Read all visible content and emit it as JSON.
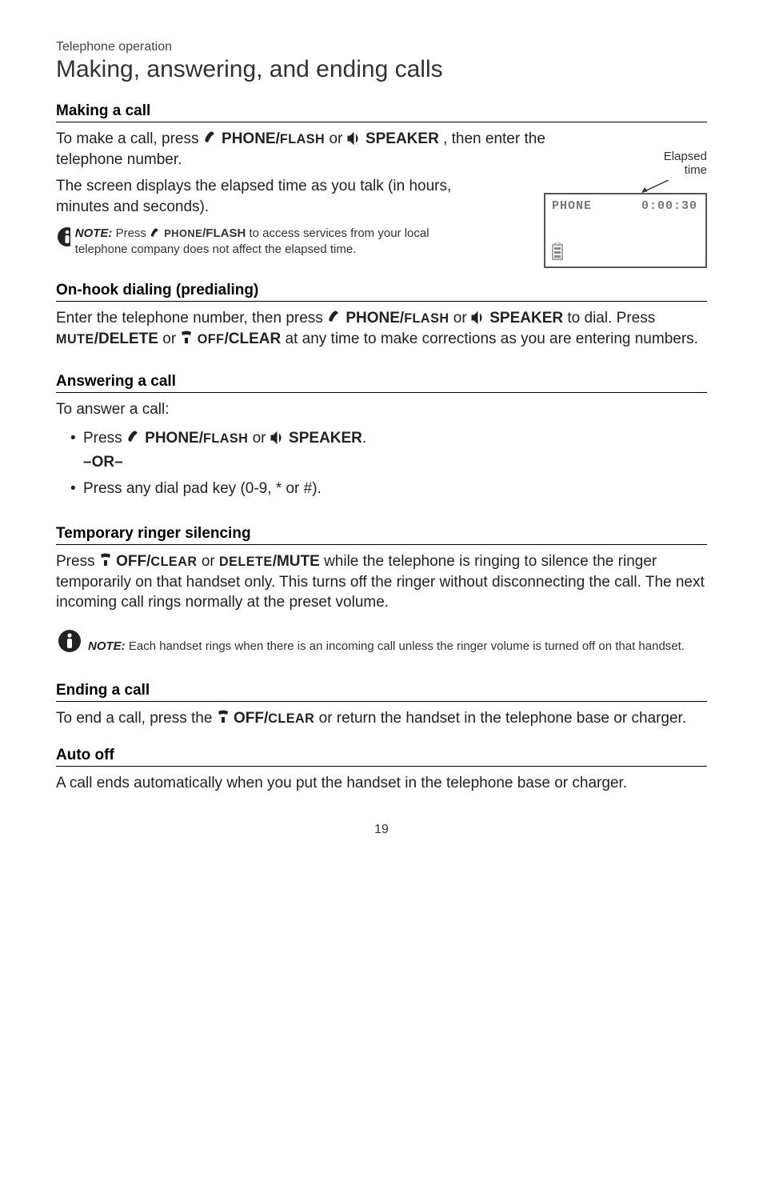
{
  "header": {
    "pre_title": "Telephone operation",
    "title": "Making, answering, and ending calls"
  },
  "making_call": {
    "heading": "Making a call",
    "p1_a": "To make a call, press ",
    "p1_phone": "PHONE/",
    "p1_flash": "FLASH",
    "p1_or": " or ",
    "p1_speaker": "SPEAKER",
    "p1_b": ", then enter the telephone number.",
    "p2": "The screen displays the elapsed time as you talk (in hours, minutes and seconds).",
    "note_label": "NOTE:",
    "note_a": " Press ",
    "note_phone": "PHONE",
    "note_flash": "/FLASH",
    "note_b": " to access services from your local telephone company does not affect the elapsed time."
  },
  "lcd": {
    "label_line1": "Elapsed",
    "label_line2": "time",
    "row_left": "PHONE",
    "row_right": "0:00:30"
  },
  "predial": {
    "heading": "On-hook dialing (predialing)",
    "p_a": "Enter the telephone number, then press ",
    "phone": "PHONE/",
    "flash": "FLASH",
    "or": " or ",
    "speaker": "SPEAKER",
    "p_b": " to dial. Press ",
    "mute": "MUTE",
    "delete": "/DELETE",
    "or2": " or ",
    "off": "OFF",
    "clear": "/CLEAR",
    "p_c": " at any time to make corrections as you are entering numbers."
  },
  "answer": {
    "heading": "Answering a call",
    "intro": "To answer a call:",
    "li1_a": "Press ",
    "li1_phone": "PHONE/",
    "li1_flash": "FLASH",
    "li1_or": " or ",
    "li1_speaker": "SPEAKER",
    "li1_dot": ".",
    "or_line": "–OR–",
    "li2": "Press any dial pad key (0-9, * or #)."
  },
  "temp_ring": {
    "heading": "Temporary ringer silencing",
    "p_a": "Press ",
    "off": "OFF/",
    "clear": "CLEAR",
    "or": " or ",
    "delete": "DELETE",
    "mute": "/MUTE",
    "p_b": " while the telephone is ringing to silence the ringer temporarily on that handset only. This turns off the ringer without disconnecting the call. The next incoming call rings normally at the preset volume.",
    "note_label": "NOTE:",
    "note_body": " Each handset rings when there is an incoming call unless the ringer volume is turned off on that handset."
  },
  "end_call": {
    "heading": "Ending a call",
    "p_a": "To end a call, press the ",
    "off": "OFF/",
    "clear": "CLEAR",
    "p_b": " or return the handset in the telephone base or charger."
  },
  "auto_off": {
    "heading": "Auto off",
    "p": "A call ends automatically when you put the handset in the telephone base or charger."
  },
  "page_number": "19"
}
